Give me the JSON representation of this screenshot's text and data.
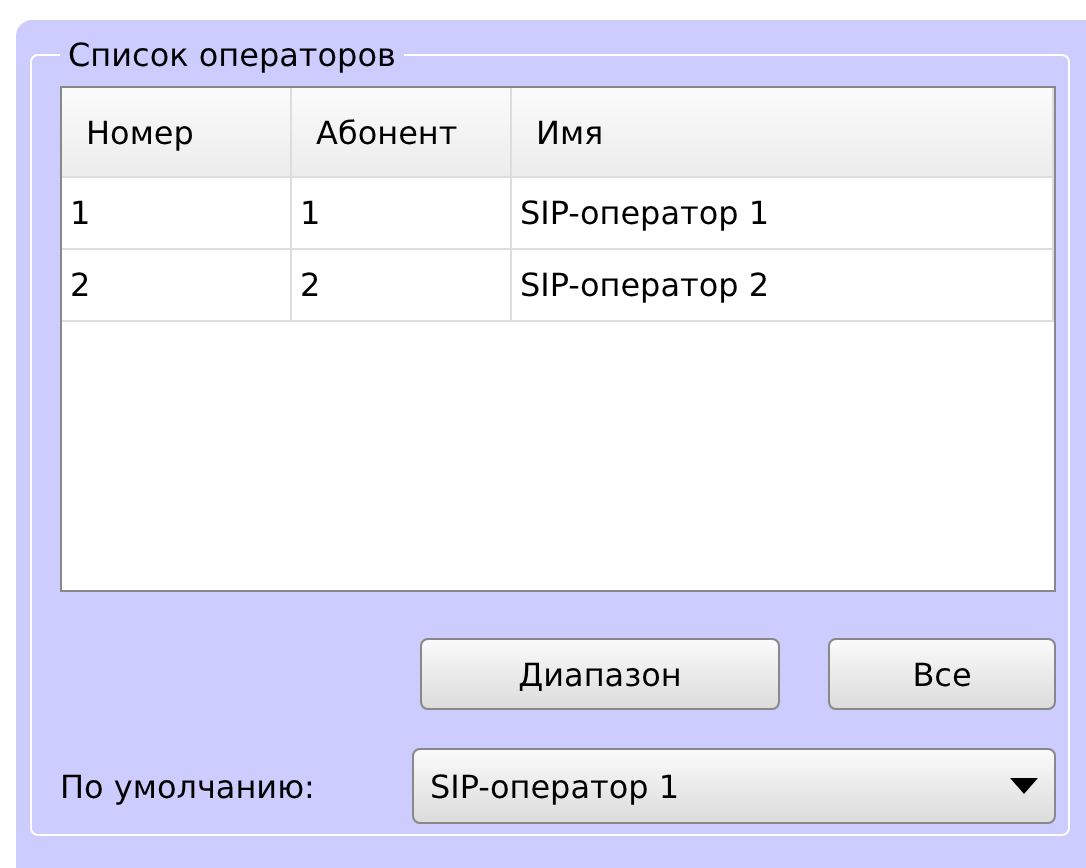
{
  "group": {
    "title": "Список операторов"
  },
  "table": {
    "columns": [
      "Номер",
      "Абонент",
      "Имя"
    ],
    "rows": [
      {
        "cells": [
          "1",
          "1",
          "SIP-оператор 1"
        ]
      },
      {
        "cells": [
          "2",
          "2",
          "SIP-оператор 2"
        ]
      }
    ]
  },
  "buttons": [
    "Диапазон",
    "Все"
  ],
  "default": {
    "label": "По умолчанию:",
    "value": "SIP-оператор 1"
  }
}
